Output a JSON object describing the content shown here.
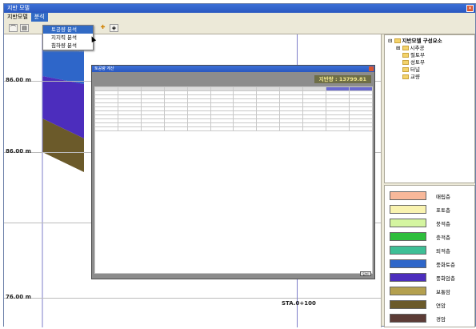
{
  "window": {
    "title": "지반 모델"
  },
  "menu": [
    {
      "label": "지반모델",
      "active": false
    },
    {
      "label": "분석",
      "active": true
    }
  ],
  "dropdown": {
    "items": [
      {
        "label": "토공량 분석",
        "highlighted": true
      },
      {
        "label": "지지력 분석",
        "highlighted": false
      },
      {
        "label": "침하량 분석",
        "highlighted": false
      }
    ]
  },
  "canvas": {
    "elevations": [
      "86.00 m",
      "86.00 m",
      "76.00 m"
    ],
    "station": "STA.0+100"
  },
  "tree": {
    "root": "지반모델 구성요소",
    "children": [
      "시추공",
      "절토부",
      "성토부",
      "터널",
      "교량"
    ]
  },
  "legend": [
    {
      "label": "매립층",
      "color": "#f8b89a"
    },
    {
      "label": "표토층",
      "color": "#f9f3b0"
    },
    {
      "label": "붕적층",
      "color": "#d4f5a0"
    },
    {
      "label": "충적층",
      "color": "#2ebe3c"
    },
    {
      "label": "퇴적층",
      "color": "#3ebf96"
    },
    {
      "label": "풍화토층",
      "color": "#2e66c9"
    },
    {
      "label": "풍화암층",
      "color": "#4c2dbd"
    },
    {
      "label": "보통암",
      "color": "#b4a04f"
    },
    {
      "label": "연암",
      "color": "#6b5a2a"
    },
    {
      "label": "경암",
      "color": "#5c3c36"
    }
  ],
  "dialog": {
    "title": "토공량 계산",
    "total": "지반량 : 13799.81",
    "button": "닫기"
  }
}
